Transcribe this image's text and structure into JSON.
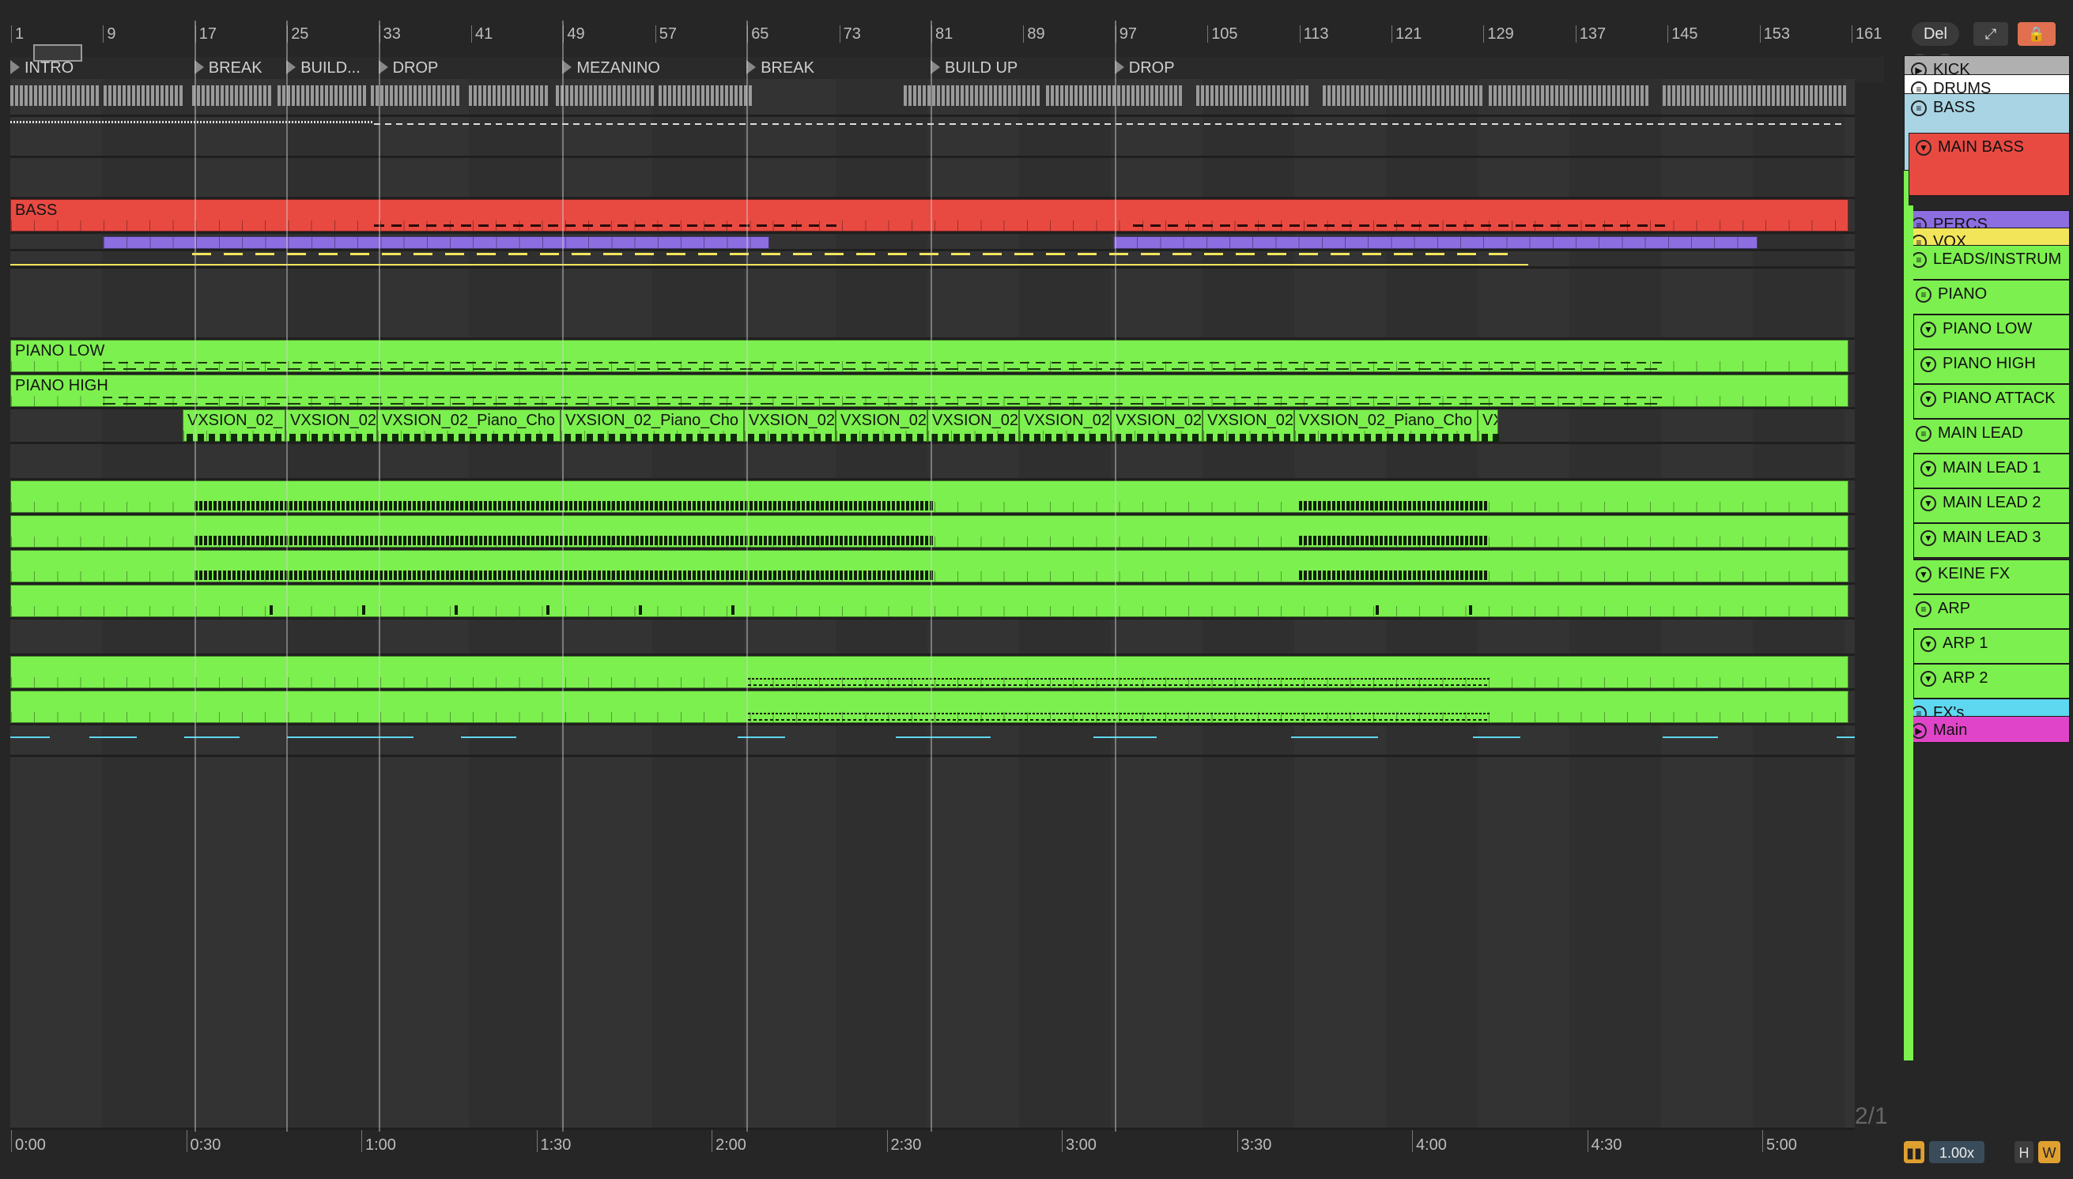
{
  "ruler": {
    "bars": [
      "1",
      "9",
      "17",
      "25",
      "33",
      "41",
      "49",
      "57",
      "65",
      "73",
      "81",
      "89",
      "97",
      "105",
      "113",
      "121",
      "129",
      "137",
      "145",
      "153",
      "161"
    ]
  },
  "locators": [
    "INTRO",
    "BREAK",
    "BUILD...",
    "DROP",
    "MEZANINO",
    "BREAK",
    "BUILD UP",
    "DROP"
  ],
  "clips": {
    "bass": "BASS",
    "piano_low": "PIANO LOW",
    "piano_high": "PIANO HIGH",
    "vxsion": [
      "VXSION_02_",
      "VXSION_02",
      "VXSION_02_Piano_Cho",
      "VXSION_02_Piano_Cho",
      "VXSION_02",
      "VXSION_02",
      "VXSION_02",
      "VXSION_02",
      "VXSION_02",
      "VXSION_02",
      "VXSION_02_Piano_Cho",
      "VX"
    ]
  },
  "tracks": [
    {
      "name": "KICK",
      "color": "#b0b0b0",
      "icon": "play-icon"
    },
    {
      "name": "DRUMS",
      "color": "#ffffff",
      "icon": "group-icon"
    },
    {
      "name": "BASS",
      "color": "#a9d4e3",
      "icon": "group-icon"
    },
    {
      "name": "MAIN BASS",
      "color": "#e84a42",
      "icon": "fold-icon"
    },
    {
      "name": "PERCS",
      "color": "#8c6ee0",
      "icon": "group-icon"
    },
    {
      "name": "VOX",
      "color": "#f2e55a",
      "icon": "group-icon"
    },
    {
      "name": "LEADS/INSTRUM",
      "color": "#7cf04e",
      "icon": "group-icon"
    },
    {
      "name": "PIANO",
      "color": "#7cf04e",
      "icon": "group-icon"
    },
    {
      "name": "PIANO LOW",
      "color": "#7cf04e",
      "icon": "fold-icon"
    },
    {
      "name": "PIANO HIGH",
      "color": "#7cf04e",
      "icon": "fold-icon"
    },
    {
      "name": "PIANO ATTACK",
      "color": "#7cf04e",
      "icon": "fold-icon"
    },
    {
      "name": "MAIN LEAD",
      "color": "#7cf04e",
      "icon": "group-icon"
    },
    {
      "name": "MAIN LEAD 1",
      "color": "#7cf04e",
      "icon": "fold-icon"
    },
    {
      "name": "MAIN LEAD 2",
      "color": "#7cf04e",
      "icon": "fold-icon"
    },
    {
      "name": "MAIN LEAD 3",
      "color": "#7cf04e",
      "icon": "fold-icon"
    },
    {
      "name": "KEINE FX",
      "color": "#7cf04e",
      "icon": "fold-icon"
    },
    {
      "name": "ARP",
      "color": "#7cf04e",
      "icon": "group-icon"
    },
    {
      "name": "ARP 1",
      "color": "#7cf04e",
      "icon": "fold-icon"
    },
    {
      "name": "ARP 2",
      "color": "#7cf04e",
      "icon": "fold-icon"
    },
    {
      "name": "FX's",
      "color": "#5ed8f0",
      "icon": "group-icon"
    },
    {
      "name": "Main",
      "color": "#e044c8",
      "icon": "play-icon"
    }
  ],
  "timeline": [
    "0:00",
    "0:30",
    "1:00",
    "1:30",
    "2:00",
    "2:30",
    "3:00",
    "3:30",
    "4:00",
    "4:30",
    "5:00"
  ],
  "controls": {
    "del": "Del",
    "zoom": "1.00x",
    "h": "H",
    "w": "W",
    "page": "2/1"
  }
}
